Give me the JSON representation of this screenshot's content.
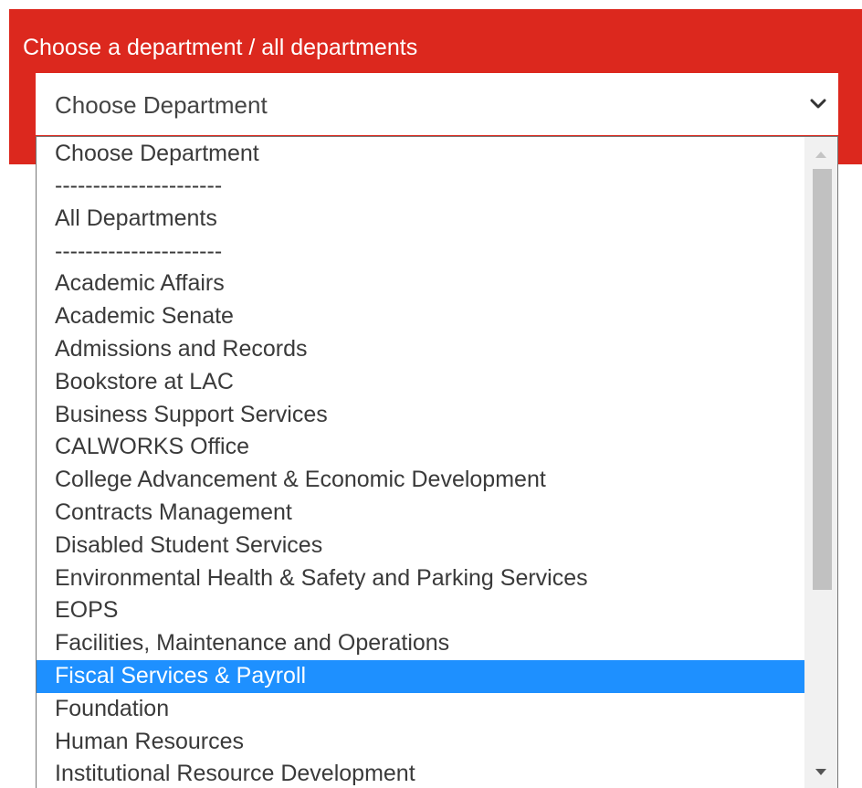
{
  "panel": {
    "label": "Choose a department / all departments",
    "background_color": "#dc281e"
  },
  "select": {
    "value": "Choose Department",
    "chevron_icon": "chevron-down-icon"
  },
  "dropdown": {
    "selected_color": "#1e90ff",
    "options": [
      "Choose Department",
      "----------------------",
      "All Departments",
      "----------------------",
      "Academic Affairs",
      "Academic Senate",
      "Admissions and Records",
      "Bookstore at LAC",
      "Business Support Services",
      "CALWORKS Office",
      "College Advancement & Economic Development",
      "Contracts Management",
      "Disabled Student Services",
      "Environmental Health & Safety and Parking Services",
      "EOPS",
      "Facilities, Maintenance and Operations",
      "Fiscal Services & Payroll",
      "Foundation",
      "Human Resources",
      "Institutional Resource Development"
    ],
    "highlighted": "Fiscal Services & Payroll"
  },
  "scrollbar": {
    "up_icon": "scroll-up-arrow-icon",
    "down_icon": "scroll-down-arrow-icon"
  }
}
